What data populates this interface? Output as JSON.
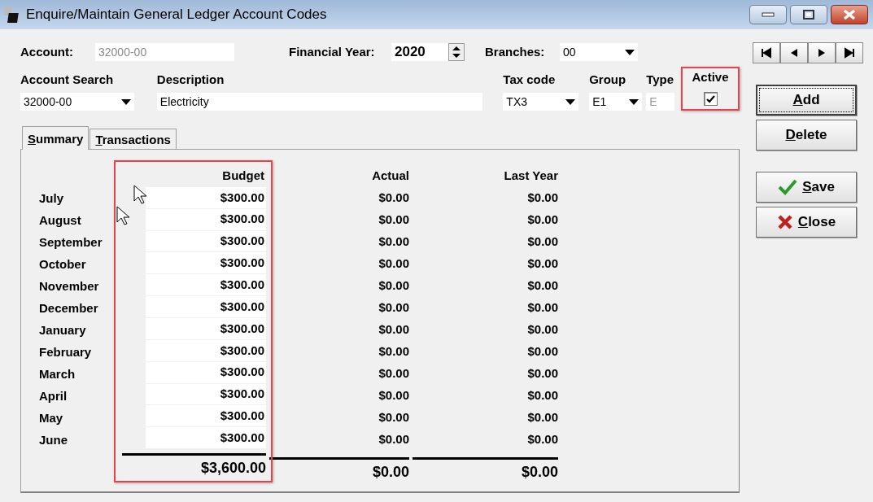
{
  "window": {
    "title": "Enquire/Maintain General Ledger Account Codes"
  },
  "header": {
    "account_label": "Account:",
    "account": "32000-00",
    "financial_year_label": "Financial Year:",
    "financial_year": "2020",
    "branches_label": "Branches:",
    "branches": "00"
  },
  "fields": [
    {
      "kind": "dropdown",
      "label": "Account Search",
      "value": "32000-00"
    },
    {
      "kind": "text",
      "label": "Description",
      "value": "Electricity"
    },
    {
      "kind": "dropdown",
      "label": "Tax code",
      "value": "TX3"
    },
    {
      "kind": "dropdown",
      "label": "Group",
      "value": "E1"
    },
    {
      "kind": "readonly",
      "label": "Type",
      "value": "E"
    },
    {
      "kind": "checkbox",
      "label": "Active",
      "checked": true,
      "highlighted": true
    }
  ],
  "tabs": [
    {
      "label": "Summary",
      "selected": true
    },
    {
      "label": "Transactions",
      "selected": false
    }
  ],
  "summary": {
    "columns": [
      "Budget",
      "Actual",
      "Last Year"
    ],
    "budget_highlighted": true,
    "rows": [
      {
        "month": "July",
        "budget": "$300.00",
        "actual": "$0.00",
        "last_year": "$0.00"
      },
      {
        "month": "August",
        "budget": "$300.00",
        "actual": "$0.00",
        "last_year": "$0.00"
      },
      {
        "month": "September",
        "budget": "$300.00",
        "actual": "$0.00",
        "last_year": "$0.00"
      },
      {
        "month": "October",
        "budget": "$300.00",
        "actual": "$0.00",
        "last_year": "$0.00"
      },
      {
        "month": "November",
        "budget": "$300.00",
        "actual": "$0.00",
        "last_year": "$0.00"
      },
      {
        "month": "December",
        "budget": "$300.00",
        "actual": "$0.00",
        "last_year": "$0.00"
      },
      {
        "month": "January",
        "budget": "$300.00",
        "actual": "$0.00",
        "last_year": "$0.00"
      },
      {
        "month": "February",
        "budget": "$300.00",
        "actual": "$0.00",
        "last_year": "$0.00"
      },
      {
        "month": "March",
        "budget": "$300.00",
        "actual": "$0.00",
        "last_year": "$0.00"
      },
      {
        "month": "April",
        "budget": "$300.00",
        "actual": "$0.00",
        "last_year": "$0.00"
      },
      {
        "month": "May",
        "budget": "$300.00",
        "actual": "$0.00",
        "last_year": "$0.00"
      },
      {
        "month": "June",
        "budget": "$300.00",
        "actual": "$0.00",
        "last_year": "$0.00"
      }
    ],
    "totals": {
      "budget": "$3,600.00",
      "actual": "$0.00",
      "last_year": "$0.00"
    }
  },
  "nav_buttons": [
    {
      "kind": "first"
    },
    {
      "kind": "previous"
    },
    {
      "kind": "next"
    },
    {
      "kind": "last"
    }
  ],
  "actions": [
    {
      "kind": "plain",
      "label": "Add",
      "focused": true
    },
    {
      "kind": "plain",
      "label": "Delete",
      "focused": false
    },
    {
      "kind": "save",
      "label": "Save",
      "focused": false
    },
    {
      "kind": "close",
      "label": "Close",
      "focused": false
    }
  ]
}
